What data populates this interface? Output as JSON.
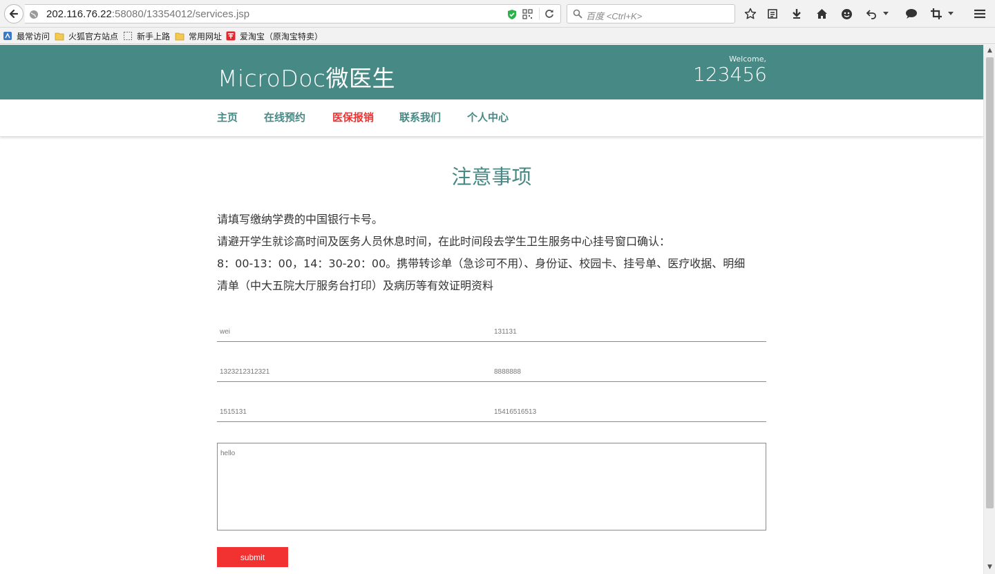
{
  "browser": {
    "url_host": "202.116.76.22",
    "url_rest": ":58080/13354012/services.jsp",
    "search_placeholder": "百度 <Ctrl+K>"
  },
  "bookmarks": [
    {
      "label": "最常访问",
      "icon": "bookmark-blue-icon"
    },
    {
      "label": "火狐官方站点",
      "icon": "folder-icon"
    },
    {
      "label": "新手上路",
      "icon": "page-dashed-icon"
    },
    {
      "label": "常用网址",
      "icon": "folder-icon"
    },
    {
      "label": "爱淘宝（原淘宝特卖）",
      "icon": "taobao-icon"
    }
  ],
  "header": {
    "logo": "MicroDoc微医生",
    "welcome": "Welcome,",
    "username": "123456"
  },
  "nav": {
    "items": [
      "主页",
      "在线预约",
      "医保报销",
      "联系我们",
      "个人中心"
    ],
    "active_index": 2
  },
  "main": {
    "title": "注意事项",
    "notice_lines": [
      "请填写缴纳学费的中国银行卡号。",
      "请避开学生就诊高时间及医务人员休息时间，在此时间段去学生卫生服务中心挂号窗口确认：",
      "8：00-13：00，14：30-20：00。携带转诊单（急诊可不用）、身份证、校园卡、挂号单、医疗收据、明细",
      "清单（中大五院大厅服务台打印）及病历等有效证明资料"
    ]
  },
  "form": {
    "fields": [
      "wei",
      "131131",
      "1323212312321",
      "8888888",
      "1515131",
      "15416516513"
    ],
    "message": "hello",
    "submit_label": "submit"
  },
  "colors": {
    "brand": "#468985",
    "accent": "#f23131",
    "active_nav": "#ee3333"
  }
}
